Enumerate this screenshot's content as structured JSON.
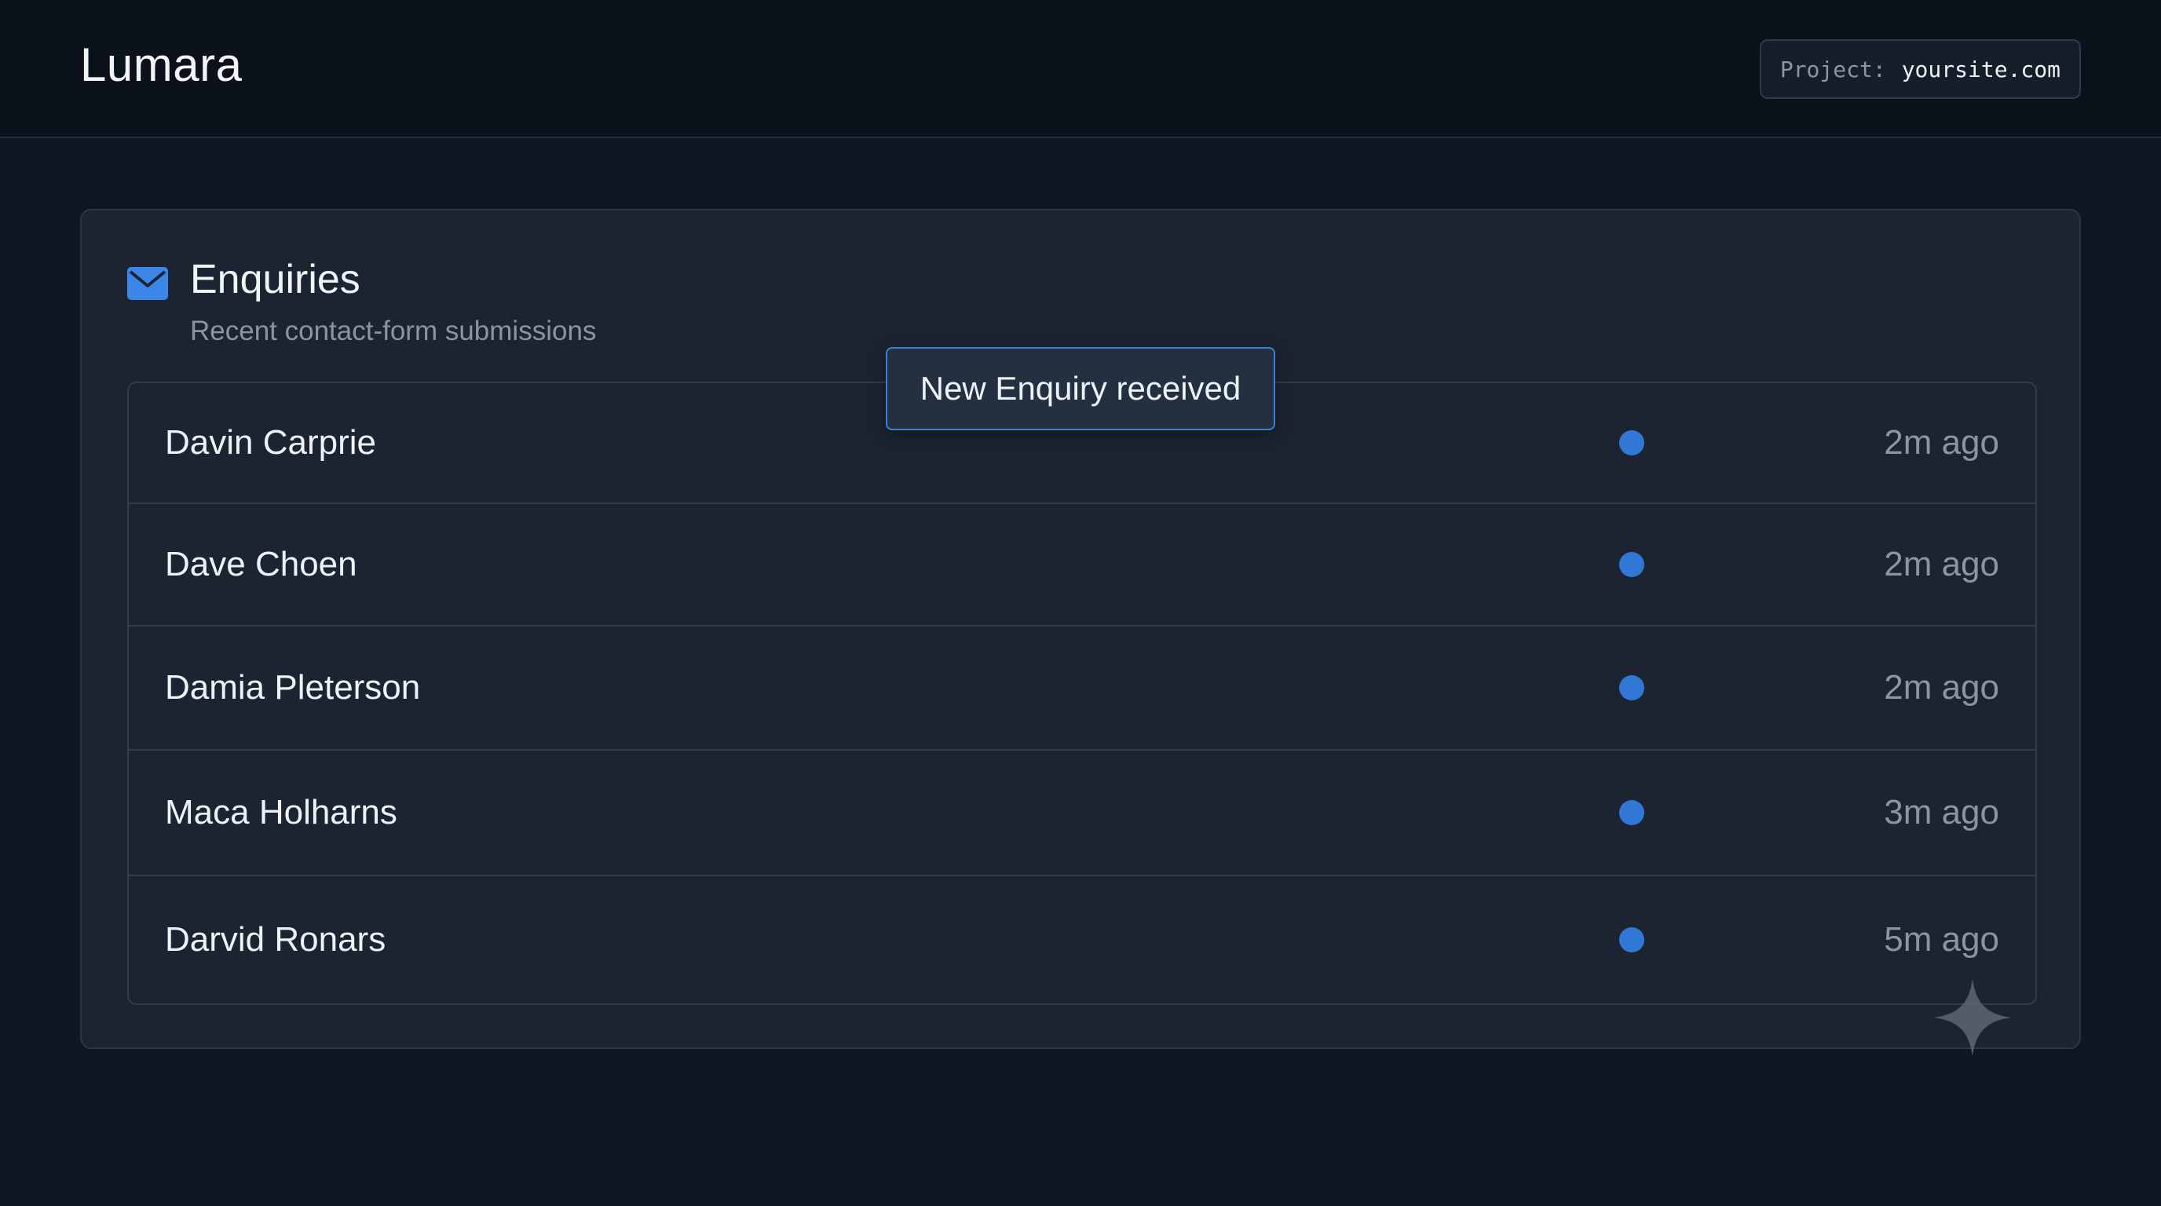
{
  "header": {
    "app_title": "Lumara",
    "project_label": "Project:",
    "project_value": "yoursite.com"
  },
  "card": {
    "icon": "mail-icon",
    "title": "Enquiries",
    "subtitle": "Recent contact-form submissions"
  },
  "toast": {
    "text": "New Enquiry received"
  },
  "enquiries": [
    {
      "name": "Davin Carprie",
      "time": "2m ago",
      "unread": true
    },
    {
      "name": "Dave Choen",
      "time": "2m ago",
      "unread": true
    },
    {
      "name": "Damia Pleterson",
      "time": "2m ago",
      "unread": true
    },
    {
      "name": "Maca Holharns",
      "time": "3m ago",
      "unread": true
    },
    {
      "name": "Darvid Ronars",
      "time": "5m ago",
      "unread": true
    }
  ],
  "colors": {
    "accent": "#3178d6",
    "background": "#0f1621",
    "card": "#1b2430"
  }
}
